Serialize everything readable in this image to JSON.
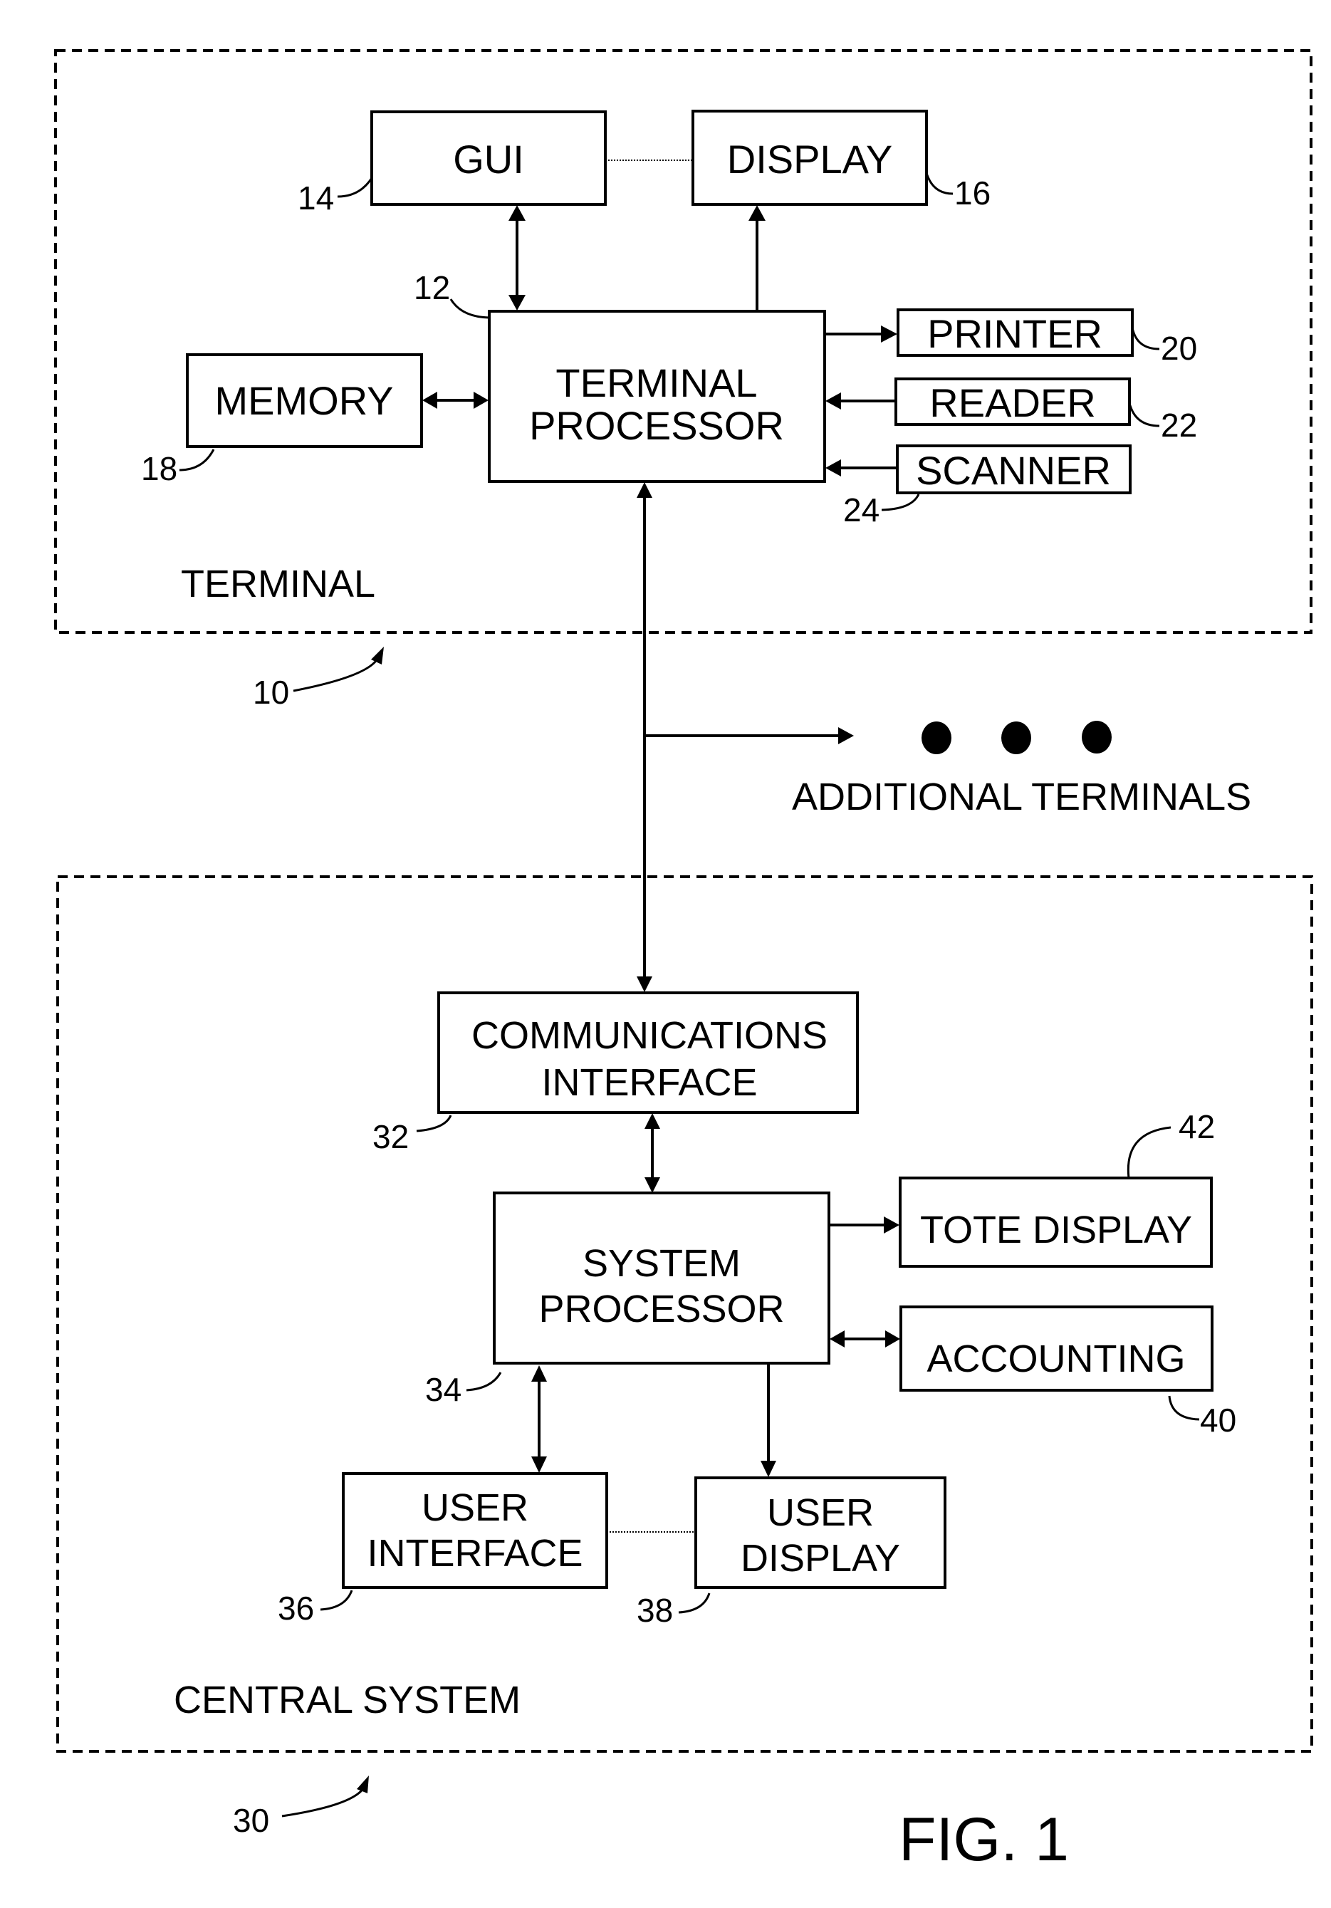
{
  "figure": {
    "caption": "FIG. 1"
  },
  "terminal": {
    "section_label": "TERMINAL",
    "ref": "10",
    "blocks": {
      "gui": {
        "label": "GUI",
        "ref": "14"
      },
      "display": {
        "label": "DISPLAY",
        "ref": "16"
      },
      "terminal_processor": {
        "line1": "TERMINAL",
        "line2": "PROCESSOR",
        "ref": "12"
      },
      "memory": {
        "label": "MEMORY",
        "ref": "18"
      },
      "printer": {
        "label": "PRINTER",
        "ref": "20"
      },
      "reader": {
        "label": "READER",
        "ref": "22"
      },
      "scanner": {
        "label": "SCANNER",
        "ref": "24"
      }
    }
  },
  "additional_terminals": {
    "label": "ADDITIONAL TERMINALS"
  },
  "central_system": {
    "section_label": "CENTRAL SYSTEM",
    "ref": "30",
    "blocks": {
      "communications_interface": {
        "line1": "COMMUNICATIONS",
        "line2": "INTERFACE",
        "ref": "32"
      },
      "system_processor": {
        "line1": "SYSTEM",
        "line2": "PROCESSOR",
        "ref": "34"
      },
      "user_interface": {
        "line1": "USER",
        "line2": "INTERFACE",
        "ref": "36"
      },
      "user_display": {
        "line1": "USER",
        "line2": "DISPLAY",
        "ref": "38"
      },
      "accounting": {
        "label": "ACCOUNTING",
        "ref": "40"
      },
      "tote_display": {
        "label": "TOTE DISPLAY",
        "ref": "42"
      }
    }
  },
  "connections": [
    {
      "from": "GUI",
      "to": "TERMINAL PROCESSOR",
      "type": "bidirectional"
    },
    {
      "from": "TERMINAL PROCESSOR",
      "to": "DISPLAY",
      "type": "directed"
    },
    {
      "from": "GUI",
      "to": "DISPLAY",
      "type": "dotted"
    },
    {
      "from": "MEMORY",
      "to": "TERMINAL PROCESSOR",
      "type": "bidirectional"
    },
    {
      "from": "TERMINAL PROCESSOR",
      "to": "PRINTER",
      "type": "directed"
    },
    {
      "from": "READER",
      "to": "TERMINAL PROCESSOR",
      "type": "directed"
    },
    {
      "from": "SCANNER",
      "to": "TERMINAL PROCESSOR",
      "type": "directed"
    },
    {
      "from": "TERMINAL PROCESSOR",
      "to": "COMMUNICATIONS INTERFACE",
      "type": "bidirectional"
    },
    {
      "from": "BUS",
      "to": "ADDITIONAL TERMINALS",
      "type": "directed"
    },
    {
      "from": "COMMUNICATIONS INTERFACE",
      "to": "SYSTEM PROCESSOR",
      "type": "bidirectional"
    },
    {
      "from": "SYSTEM PROCESSOR",
      "to": "TOTE DISPLAY",
      "type": "directed"
    },
    {
      "from": "SYSTEM PROCESSOR",
      "to": "ACCOUNTING",
      "type": "bidirectional"
    },
    {
      "from": "SYSTEM PROCESSOR",
      "to": "USER INTERFACE",
      "type": "bidirectional"
    },
    {
      "from": "SYSTEM PROCESSOR",
      "to": "USER DISPLAY",
      "type": "directed"
    },
    {
      "from": "USER INTERFACE",
      "to": "USER DISPLAY",
      "type": "dotted"
    }
  ]
}
